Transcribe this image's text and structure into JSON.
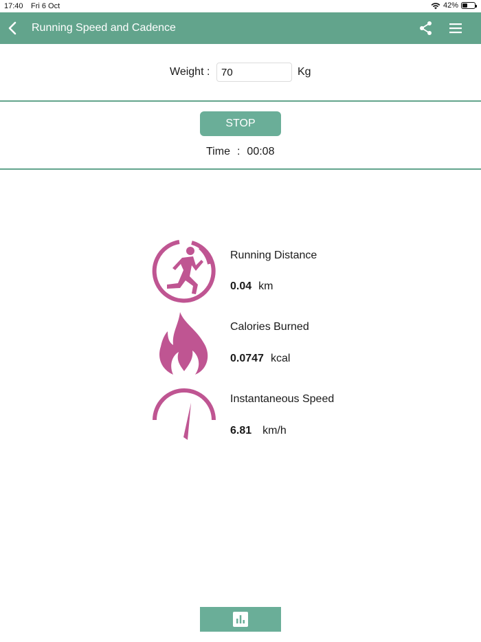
{
  "status_bar": {
    "time": "17:40",
    "date": "Fri 6 Oct",
    "battery_percent": "42%",
    "battery_level": 0.42,
    "icons": [
      "wifi-icon",
      "battery-icon"
    ]
  },
  "nav": {
    "title": "Running Speed and Cadence",
    "icons": [
      "back-icon",
      "share-icon",
      "menu-icon"
    ],
    "color": "#62a48c"
  },
  "weight": {
    "label": "Weight :",
    "value": "70",
    "unit": "Kg"
  },
  "control": {
    "stop_label": "STOP",
    "time_label": "Time",
    "time_sep": ":",
    "time_value": "00:08"
  },
  "metrics": [
    {
      "icon": "runner-icon",
      "label": "Running Distance",
      "value": "0.04",
      "unit": "km"
    },
    {
      "icon": "flame-icon",
      "label": "Calories Burned",
      "value": "0.0747",
      "unit": "kcal"
    },
    {
      "icon": "speedometer-icon",
      "label": "Instantaneous Speed",
      "value": "6.81",
      "unit": "km/h"
    }
  ],
  "bottom": {
    "icon": "bar-chart-icon"
  },
  "colors": {
    "accent": "#62a48c",
    "icon_pink": "#bf5592"
  }
}
